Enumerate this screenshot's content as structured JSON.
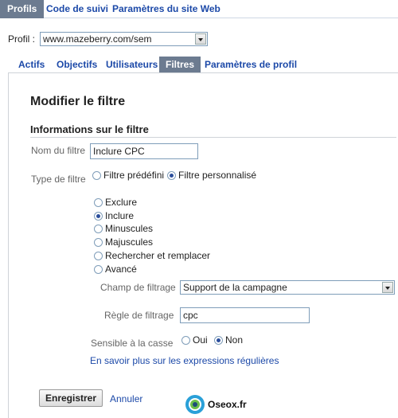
{
  "top_tabs": [
    "Profils",
    "Code de suivi",
    "Paramètres du site Web"
  ],
  "profile": {
    "label": "Profil :",
    "value": "www.mazeberry.com/sem"
  },
  "sub_tabs": [
    "Actifs",
    "Objectifs",
    "Utilisateurs",
    "Filtres",
    "Paramètres de profil"
  ],
  "form": {
    "heading": "Modifier le filtre",
    "section_title": "Informations sur le filtre",
    "filter_name_label": "Nom du filtre",
    "filter_name_value": "Inclure CPC",
    "filter_type_label": "Type de filtre",
    "filter_type_options": [
      "Filtre prédéfini",
      "Filtre personnalisé"
    ],
    "filter_type_selected": "Filtre personnalisé",
    "custom_options": [
      "Exclure",
      "Inclure",
      "Minuscules",
      "Majuscules",
      "Rechercher et remplacer",
      "Avancé"
    ],
    "custom_selected": "Inclure",
    "field_label": "Champ de filtrage",
    "field_value": "Support de la campagne",
    "rule_label": "Règle de filtrage",
    "rule_value": "cpc",
    "case_label": "Sensible à la casse",
    "case_options": [
      "Oui",
      "Non"
    ],
    "case_selected": "Non",
    "regex_link": "En savoir plus sur les expressions régulières",
    "save_button": "Enregistrer",
    "cancel_link": "Annuler"
  },
  "watermark": "Oseox.fr",
  "icons": {
    "dropdown": "chevron-down-icon",
    "logo": "oseox-logo-icon"
  },
  "colors": {
    "active_tab": "#6c7b90",
    "link": "#1c49a8"
  }
}
